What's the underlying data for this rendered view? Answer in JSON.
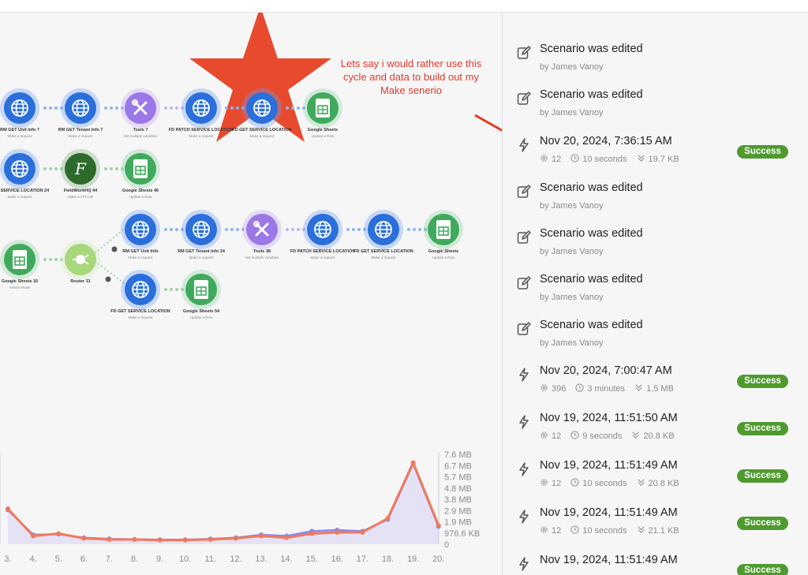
{
  "annotation": {
    "lines": [
      "Lets say i would rather use this",
      "cycle and data to build out my",
      "Make senerio"
    ]
  },
  "colors": {
    "success": "#4f9a2f",
    "annotation": "#e03a2a",
    "line_primary": "#f07a5a",
    "line_secondary": "#8b86f0"
  },
  "flow": {
    "row1": [
      {
        "name": "RM GET Unit Info",
        "num": "7",
        "sub": "Make a request",
        "icon": "globe-icon"
      },
      {
        "name": "RM GET Tenant Info",
        "num": "7",
        "sub": "Make a request",
        "icon": "globe-icon"
      },
      {
        "name": "Tools",
        "num": "7",
        "sub": "Set multiple variables",
        "icon": "tools-icon"
      },
      {
        "name": "FD PATCH SERVICE LOCATION",
        "num": "",
        "sub": "Make a request",
        "icon": "globe-icon"
      },
      {
        "name": "FD GET SERVICE LOCATION",
        "num": "",
        "sub": "Make a request",
        "icon": "globe-icon"
      },
      {
        "name": "Google Sheets",
        "num": "",
        "sub": "Update a Row",
        "icon": "sheets-icon"
      }
    ],
    "row2": [
      {
        "name": "GET SERVICE LOCATION",
        "num": "24",
        "sub": "Make a request",
        "icon": "globe-icon"
      },
      {
        "name": "FieldWorkHQ",
        "num": "44",
        "sub": "Make a API Call",
        "icon": "fieldworkhq-icon"
      },
      {
        "name": "Google Sheets",
        "num": "46",
        "sub": "Update a Row",
        "icon": "sheets-icon"
      }
    ],
    "row3_source": {
      "name": "Google Sheets",
      "num": "16",
      "sub": "Search Rows",
      "icon": "sheets-icon"
    },
    "router": {
      "name": "Router",
      "num": "31",
      "icon": "router-icon"
    },
    "row3": [
      {
        "name": "RM GET Unit Info",
        "num": "",
        "sub": "Make a request",
        "icon": "globe-icon"
      },
      {
        "name": "RM GET Tenant Info",
        "num": "34",
        "sub": "Make a request",
        "icon": "globe-icon"
      },
      {
        "name": "Tools",
        "num": "38",
        "sub": "Set multiple variables",
        "icon": "tools-icon"
      },
      {
        "name": "FD PATCH SERVICE LOCATION",
        "num": "",
        "sub": "Make a request",
        "icon": "globe-icon"
      },
      {
        "name": "FD GET SERVICE LOCATION",
        "num": "",
        "sub": "Make a request",
        "icon": "globe-icon"
      },
      {
        "name": "Google Sheets",
        "num": "",
        "sub": "Update a Row",
        "icon": "sheets-icon"
      }
    ],
    "row4": [
      {
        "name": "FD GET SERVICE LOCATION",
        "num": "",
        "sub": "Make a request",
        "icon": "globe-icon"
      },
      {
        "name": "Google Sheets",
        "num": "54",
        "sub": "Update a Row",
        "icon": "sheets-icon"
      }
    ]
  },
  "chart_data": {
    "type": "line",
    "x_ticks": [
      "3.",
      "4.",
      "5.",
      "6.",
      "7.",
      "8.",
      "9.",
      "10.",
      "11.",
      "12.",
      "13.",
      "14.",
      "15.",
      "16.",
      "17.",
      "18.",
      "19.",
      "20."
    ],
    "y_ticks": [
      "7.6 MB",
      "6.7 MB",
      "5.7 MB",
      "4.8 MB",
      "3.8 MB",
      "2.9 MB",
      "1.9 MB",
      "976.6 KB",
      "0"
    ],
    "ylim_mb": [
      0,
      7.6
    ],
    "series": [
      {
        "color": "#f07a5a",
        "values_mb": [
          3.0,
          0.7,
          0.9,
          0.5,
          0.4,
          0.4,
          0.35,
          0.35,
          0.4,
          0.5,
          0.7,
          0.55,
          0.9,
          1.0,
          1.0,
          2.2,
          6.9,
          1.6
        ]
      },
      {
        "color": "#8b86f0",
        "values_mb": [
          2.9,
          0.8,
          0.85,
          0.55,
          0.45,
          0.42,
          0.38,
          0.38,
          0.45,
          0.55,
          0.8,
          0.7,
          1.1,
          1.2,
          1.1,
          2.1,
          6.8,
          1.5
        ]
      }
    ],
    "area_fill": "#e6e2f6"
  },
  "activity": [
    {
      "kind": "edit",
      "title": "Scenario was edited",
      "sub": "by James Vanoy"
    },
    {
      "kind": "edit",
      "title": "Scenario was edited",
      "sub": "by James Vanoy"
    },
    {
      "kind": "run",
      "title": "Nov 20, 2024, 7:36:15 AM",
      "ops": "12",
      "duration": "10 seconds",
      "size": "19.7 KB",
      "status": "Success"
    },
    {
      "kind": "edit",
      "title": "Scenario was edited",
      "sub": "by James Vanoy"
    },
    {
      "kind": "edit",
      "title": "Scenario was edited",
      "sub": "by James Vanoy"
    },
    {
      "kind": "edit",
      "title": "Scenario was edited",
      "sub": "by James Vanoy"
    },
    {
      "kind": "edit",
      "title": "Scenario was edited",
      "sub": "by James Vanoy"
    },
    {
      "kind": "run",
      "title": "Nov 20, 2024, 7:00:47 AM",
      "ops": "396",
      "duration": "3 minutes",
      "size": "1.5 MB",
      "status": "Success"
    },
    {
      "kind": "run",
      "title": "Nov 19, 2024, 11:51:50 AM",
      "ops": "12",
      "duration": "9 seconds",
      "size": "20.8 KB",
      "status": "Success"
    },
    {
      "kind": "run",
      "title": "Nov 19, 2024, 11:51:49 AM",
      "ops": "12",
      "duration": "10 seconds",
      "size": "20.8 KB",
      "status": "Success"
    },
    {
      "kind": "run",
      "title": "Nov 19, 2024, 11:51:49 AM",
      "ops": "12",
      "duration": "10 seconds",
      "size": "21.1 KB",
      "status": "Success"
    },
    {
      "kind": "run",
      "title": "Nov 19, 2024, 11:51:49 AM",
      "ops": "",
      "duration": "",
      "size": "",
      "status": "Success"
    }
  ]
}
